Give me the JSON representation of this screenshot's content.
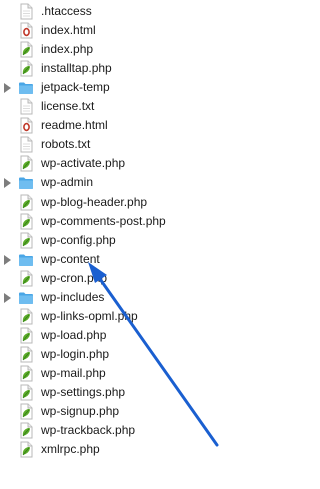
{
  "file_list": {
    "items": [
      {
        "name": ".htaccess",
        "kind": "text",
        "icon": "text-file-icon"
      },
      {
        "name": "index.html",
        "kind": "html",
        "icon": "html-file-icon"
      },
      {
        "name": "index.php",
        "kind": "php",
        "icon": "php-file-icon"
      },
      {
        "name": "installtap.php",
        "kind": "php",
        "icon": "php-file-icon"
      },
      {
        "name": "jetpack-temp",
        "kind": "folder",
        "icon": "folder-icon"
      },
      {
        "name": "license.txt",
        "kind": "text",
        "icon": "text-file-icon"
      },
      {
        "name": "readme.html",
        "kind": "html",
        "icon": "html-file-icon"
      },
      {
        "name": "robots.txt",
        "kind": "text",
        "icon": "text-file-icon"
      },
      {
        "name": "wp-activate.php",
        "kind": "php",
        "icon": "php-file-icon"
      },
      {
        "name": "wp-admin",
        "kind": "folder",
        "icon": "folder-icon"
      },
      {
        "name": "wp-blog-header.php",
        "kind": "php",
        "icon": "php-file-icon"
      },
      {
        "name": "wp-comments-post.php",
        "kind": "php",
        "icon": "php-file-icon"
      },
      {
        "name": "wp-config.php",
        "kind": "php",
        "icon": "php-file-icon"
      },
      {
        "name": "wp-content",
        "kind": "folder",
        "icon": "folder-icon"
      },
      {
        "name": "wp-cron.php",
        "kind": "php",
        "icon": "php-file-icon"
      },
      {
        "name": "wp-includes",
        "kind": "folder",
        "icon": "folder-icon"
      },
      {
        "name": "wp-links-opml.php",
        "kind": "php",
        "icon": "php-file-icon"
      },
      {
        "name": "wp-load.php",
        "kind": "php",
        "icon": "php-file-icon"
      },
      {
        "name": "wp-login.php",
        "kind": "php",
        "icon": "php-file-icon"
      },
      {
        "name": "wp-mail.php",
        "kind": "php",
        "icon": "php-file-icon"
      },
      {
        "name": "wp-settings.php",
        "kind": "php",
        "icon": "php-file-icon"
      },
      {
        "name": "wp-signup.php",
        "kind": "php",
        "icon": "php-file-icon"
      },
      {
        "name": "wp-trackback.php",
        "kind": "php",
        "icon": "php-file-icon"
      },
      {
        "name": "xmlrpc.php",
        "kind": "php",
        "icon": "php-file-icon"
      }
    ]
  },
  "annotation": {
    "icon": "arrow-icon",
    "color": "#1a5fd0",
    "points_to": "wp-content"
  },
  "colors": {
    "folder": "#4aa6e6",
    "php_leaf": "#5cab2a",
    "html_badge": "#c0392b",
    "disclosure": "#7d7d7d"
  }
}
